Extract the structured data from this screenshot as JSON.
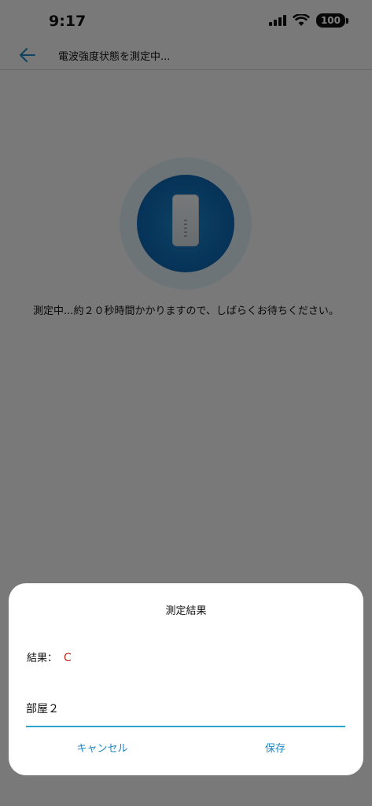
{
  "status_bar": {
    "time": "9:17",
    "battery": "100"
  },
  "nav": {
    "title": "電波強度状態を測定中..."
  },
  "measuring": {
    "message": "測定中...約２０秒時間かかりますので、しばらくお待ちください。"
  },
  "dialog": {
    "title": "測定結果",
    "result_label": "結果：",
    "result_value": "C",
    "room_value": "部屋２",
    "cancel_label": "キャンセル",
    "save_label": "保存"
  },
  "colors": {
    "accent": "#1e86c1",
    "result": "#c8261f",
    "input_underline": "#2da4cd"
  },
  "icons": [
    "back-arrow-icon",
    "cellular-signal-icon",
    "wifi-icon",
    "battery-icon",
    "router-device-icon"
  ]
}
